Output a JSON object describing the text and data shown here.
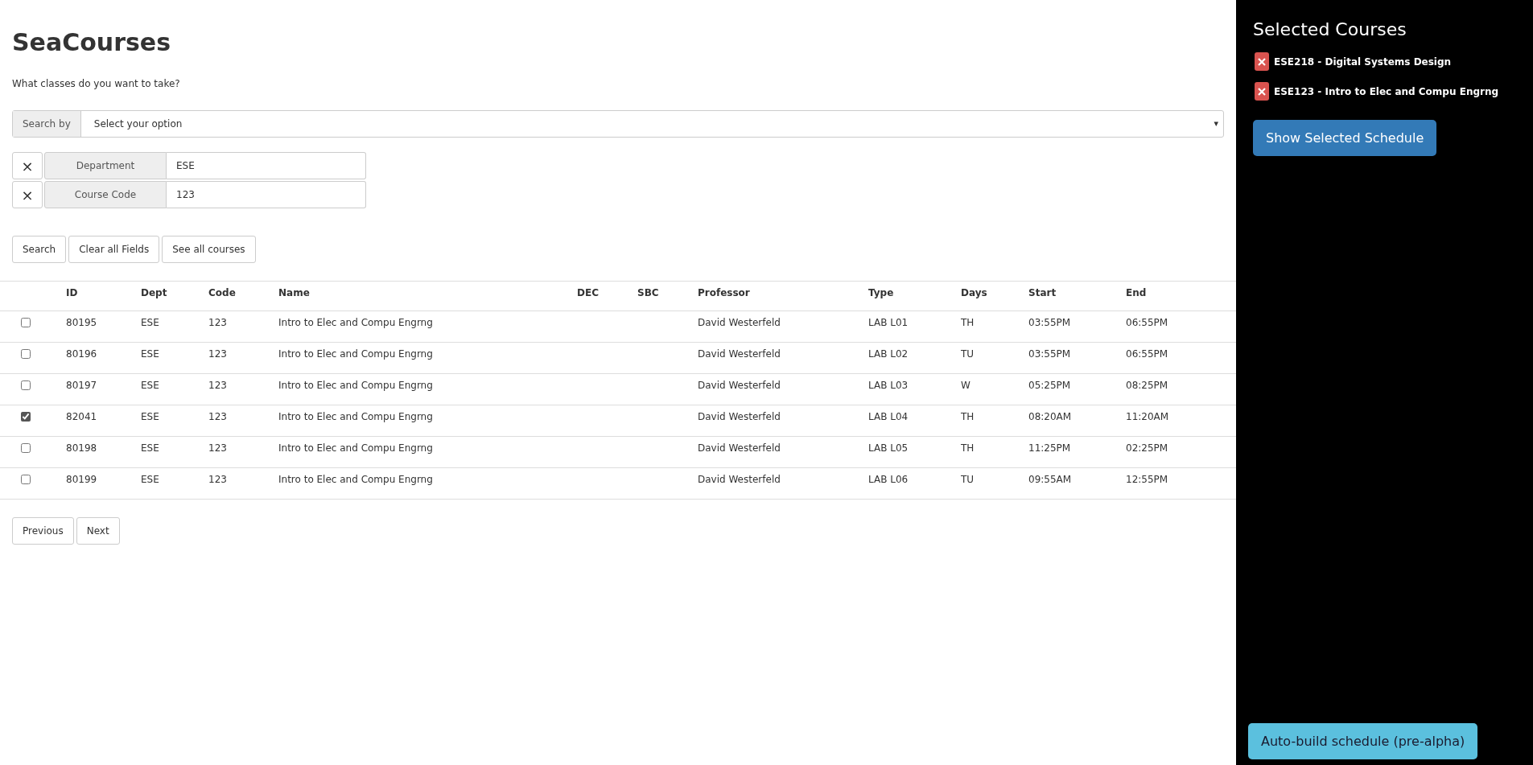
{
  "title": "SeaCourses",
  "subtitle": "What classes do you want to take?",
  "search_by": {
    "label": "Search by",
    "value": "Select your option",
    "caret": "▾"
  },
  "filters": [
    {
      "remove": "×",
      "label": "Department",
      "value": "ESE"
    },
    {
      "remove": "×",
      "label": "Course Code",
      "value": "123"
    }
  ],
  "actions": [
    "Search",
    "Clear all Fields",
    "See all courses"
  ],
  "table": {
    "columns": [
      "ID",
      "Dept",
      "Code",
      "Name",
      "DEC",
      "SBC",
      "Professor",
      "Type",
      "Days",
      "Start",
      "End"
    ],
    "rows": [
      {
        "checked": false,
        "cells": [
          "80195",
          "ESE",
          "123",
          "Intro to Elec and Compu Engrng",
          "",
          "",
          "David Westerfeld",
          "LAB L01",
          "TH",
          "03:55PM",
          "06:55PM"
        ]
      },
      {
        "checked": false,
        "cells": [
          "80196",
          "ESE",
          "123",
          "Intro to Elec and Compu Engrng",
          "",
          "",
          "David Westerfeld",
          "LAB L02",
          "TU",
          "03:55PM",
          "06:55PM"
        ]
      },
      {
        "checked": false,
        "cells": [
          "80197",
          "ESE",
          "123",
          "Intro to Elec and Compu Engrng",
          "",
          "",
          "David Westerfeld",
          "LAB L03",
          "W",
          "05:25PM",
          "08:25PM"
        ]
      },
      {
        "checked": true,
        "cells": [
          "82041",
          "ESE",
          "123",
          "Intro to Elec and Compu Engrng",
          "",
          "",
          "David Westerfeld",
          "LAB L04",
          "TH",
          "08:20AM",
          "11:20AM"
        ]
      },
      {
        "checked": false,
        "cells": [
          "80198",
          "ESE",
          "123",
          "Intro to Elec and Compu Engrng",
          "",
          "",
          "David Westerfeld",
          "LAB L05",
          "TH",
          "11:25PM",
          "02:25PM"
        ]
      },
      {
        "checked": false,
        "cells": [
          "80199",
          "ESE",
          "123",
          "Intro to Elec and Compu Engrng",
          "",
          "",
          "David Westerfeld",
          "LAB L06",
          "TU",
          "09:55AM",
          "12:55PM"
        ]
      }
    ]
  },
  "pagination": [
    "Previous",
    "Next"
  ],
  "sidebar": {
    "title": "Selected Courses",
    "courses": [
      "ESE218 - Digital Systems Design",
      "ESE123 - Intro to Elec and Compu Engrng"
    ],
    "show_button": "Show Selected Schedule",
    "auto_button": "Auto-build schedule (pre-alpha)"
  }
}
